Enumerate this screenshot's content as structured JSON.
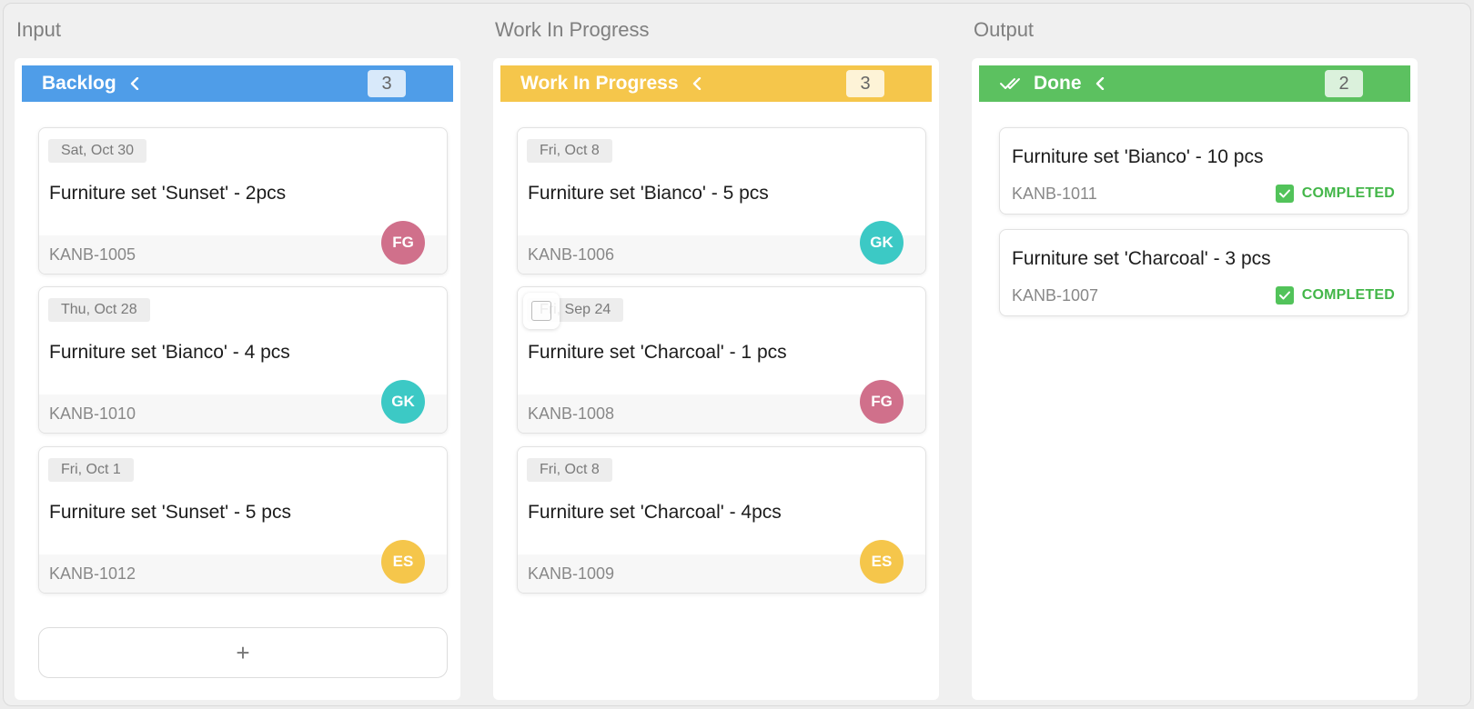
{
  "sections": {
    "input": "Input",
    "wip": "Work In Progress",
    "output": "Output"
  },
  "colors": {
    "backlog": "#4f9de8",
    "wip": "#f5c64b",
    "done": "#5cc160",
    "avatar_fg": "#d0708b",
    "avatar_gk": "#3cc9c5",
    "avatar_es": "#f5c64b"
  },
  "columns": {
    "backlog": {
      "label": "Backlog",
      "count": "3",
      "cards": [
        {
          "date": "Sat, Oct 30",
          "title": "Furniture set 'Sunset' - 2pcs",
          "code": "KANB-1005",
          "assignee": "FG"
        },
        {
          "date": "Thu, Oct 28",
          "title": "Furniture set 'Bianco' - 4 pcs",
          "code": "KANB-1010",
          "assignee": "GK"
        },
        {
          "date": "Fri, Oct 1",
          "title": "Furniture set 'Sunset' - 5 pcs",
          "code": "KANB-1012",
          "assignee": "ES"
        }
      ],
      "add_label": "+"
    },
    "wip": {
      "label": "Work In Progress",
      "count": "3",
      "cards": [
        {
          "date": "Fri, Oct 8",
          "title": "Furniture set 'Bianco' - 5 pcs",
          "code": "KANB-1006",
          "assignee": "GK"
        },
        {
          "date": "Fri, Sep 24",
          "title": "Furniture set 'Charcoal' - 1 pcs",
          "code": "KANB-1008",
          "assignee": "FG"
        },
        {
          "date": "Fri, Oct 8",
          "title": "Furniture set 'Charcoal' - 4pcs",
          "code": "KANB-1009",
          "assignee": "ES"
        }
      ]
    },
    "done": {
      "label": "Done",
      "count": "2",
      "header_icon": "double-check-icon",
      "cards": [
        {
          "title": "Furniture set 'Bianco' - 10 pcs",
          "code": "KANB-1011",
          "status": "COMPLETED"
        },
        {
          "title": "Furniture set 'Charcoal' - 3 pcs",
          "code": "KANB-1007",
          "status": "COMPLETED"
        }
      ]
    }
  }
}
